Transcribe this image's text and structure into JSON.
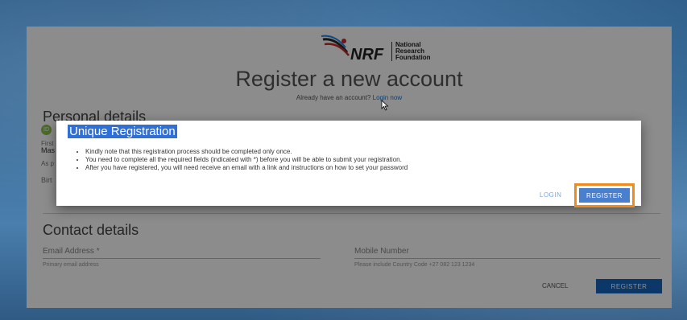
{
  "logo": {
    "abbr": "NRF",
    "name_lines": [
      "National",
      "Research",
      "Foundation"
    ]
  },
  "page": {
    "title": "Register a new account",
    "login_prompt": "Already have an account?",
    "login_link": "Login now"
  },
  "personal": {
    "section_title": "Personal details",
    "id_badge": "ID",
    "peek_first": "First",
    "peek_mas": "Mas",
    "peek_as": "As p",
    "peek_birth": "Birt"
  },
  "contact": {
    "section_title": "Contact details",
    "email_label": "Email Address *",
    "email_help": "Primary email address",
    "mobile_label": "Mobile Number",
    "mobile_help": "Please include Country Code +27 082 123 1234"
  },
  "footer": {
    "cancel_label": "CANCEL",
    "register_label": "REGISTER"
  },
  "modal": {
    "title": "Unique Registration",
    "items": [
      "Kindly note that this registration process should be completed only once.",
      "You need to complete all the required fields (indicated with *) before you will be able to submit your registration.",
      "After you have registered, you will need receive an email with a link and instructions on how to set your password"
    ],
    "login_label": "LOGIN",
    "register_label": "REGISTER"
  },
  "colors": {
    "primary": "#1565c0",
    "highlight": "#f08a1c",
    "title_highlight": "#2f6fd6"
  }
}
